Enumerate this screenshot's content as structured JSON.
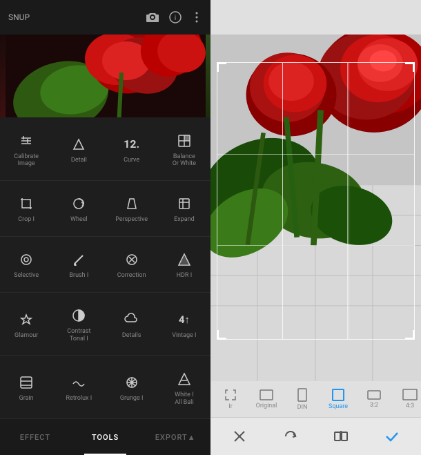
{
  "left_panel": {
    "header": {
      "title": "SNUP",
      "icons": [
        "camera-icon",
        "info-icon",
        "more-icon"
      ]
    },
    "tools": [
      {
        "id": "calibrate",
        "icon": "⊞",
        "label": "Calibrate\nImage"
      },
      {
        "id": "detail",
        "icon": "▽",
        "label": "Detail"
      },
      {
        "id": "curve",
        "icon": "12.",
        "label": "Curve"
      },
      {
        "id": "balance",
        "icon": "⊡",
        "label": "Balance\nOr White"
      },
      {
        "id": "crop",
        "icon": "⌐",
        "label": "Crop I"
      },
      {
        "id": "wheel",
        "icon": "↺",
        "label": "Wheel"
      },
      {
        "id": "perspective",
        "icon": "⊡",
        "label": "Perspective"
      },
      {
        "id": "expand",
        "icon": "⊞",
        "label": "Expand"
      },
      {
        "id": "selective",
        "icon": "◎",
        "label": "Selective"
      },
      {
        "id": "brush",
        "icon": "∕",
        "label": "Brush I"
      },
      {
        "id": "correction",
        "icon": "✕",
        "label": "Correction"
      },
      {
        "id": "hdr",
        "icon": "△",
        "label": "HDR I"
      },
      {
        "id": "glamour",
        "icon": "◇",
        "label": "Glamour"
      },
      {
        "id": "contrast",
        "icon": "◑",
        "label": "Contrast\nTonal I"
      },
      {
        "id": "details2",
        "icon": "☁",
        "label": "Details"
      },
      {
        "id": "vintage",
        "icon": "4↑",
        "label": "Vintage I"
      },
      {
        "id": "grain",
        "icon": "⊟",
        "label": "Grain"
      },
      {
        "id": "retrolux",
        "icon": "∼",
        "label": "Retrolux I"
      },
      {
        "id": "grunge",
        "icon": "❊",
        "label": "Grunge I"
      },
      {
        "id": "white",
        "icon": "△",
        "label": "White I\nAll Bali"
      }
    ],
    "tabs": [
      {
        "id": "effect",
        "label": "EFFECT",
        "active": false
      },
      {
        "id": "tools",
        "label": "TOOLS",
        "active": true
      },
      {
        "id": "export",
        "label": "EXPORT▲",
        "active": false
      }
    ]
  },
  "right_panel": {
    "ratio_options": [
      {
        "id": "free",
        "icon": "◱",
        "label": "Ir",
        "selected": false
      },
      {
        "id": "original",
        "icon": "▭",
        "label": "Original",
        "selected": false
      },
      {
        "id": "din",
        "icon": "▭",
        "label": "DIN",
        "selected": false
      },
      {
        "id": "square",
        "icon": "□",
        "label": "Square",
        "selected": true
      },
      {
        "id": "r32",
        "icon": "▭",
        "label": "3:2",
        "selected": false
      },
      {
        "id": "r43",
        "icon": "▭",
        "label": "4:3",
        "selected": false
      },
      {
        "id": "more",
        "icon": "▭",
        "label": "",
        "selected": false
      }
    ],
    "actions": {
      "cancel": "✕",
      "rotate": "↺",
      "flip": "⊟",
      "confirm": "✓"
    }
  }
}
